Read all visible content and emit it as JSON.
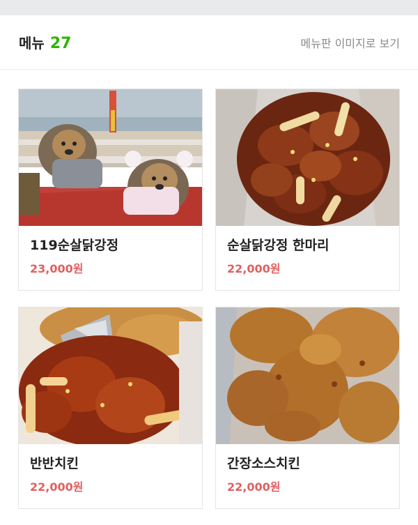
{
  "header": {
    "menu_label": "메뉴",
    "menu_count": "27",
    "view_as_image": "메뉴판 이미지로 보기"
  },
  "items": [
    {
      "name": "119순살닭강정",
      "price": "23,000원",
      "photo": "dogs-beach-photo"
    },
    {
      "name": "순살닭강정 한마리",
      "price": "22,000원",
      "photo": "spicy-boneless-chicken-photo"
    },
    {
      "name": "반반치킨",
      "price": "22,000원",
      "photo": "half-half-chicken-photo"
    },
    {
      "name": "간장소스치킨",
      "price": "22,000원",
      "photo": "soy-sauce-chicken-photo"
    }
  ]
}
